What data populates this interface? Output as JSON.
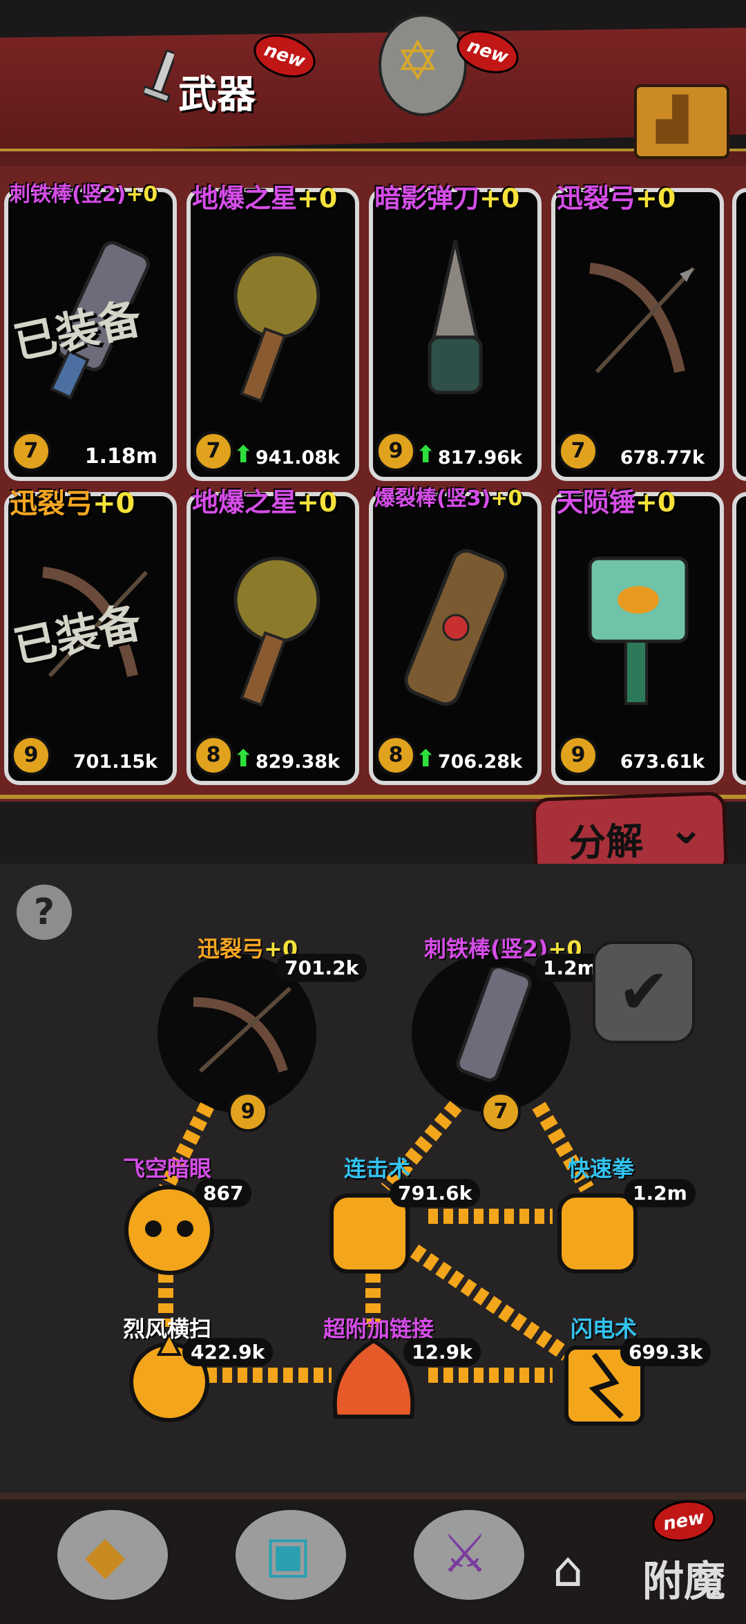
{
  "header": {
    "title": "武器",
    "new_badge_1": "new",
    "new_badge_2": "new"
  },
  "weapons": [
    {
      "name": "刺铁棒(竖2)",
      "plus": "+0",
      "level": "7",
      "value": "1.18m",
      "upgrade": false,
      "equipped_label": "已装备",
      "name_color": "#d64ee8"
    },
    {
      "name": "地爆之星",
      "plus": "+0",
      "level": "7",
      "value": "941.08k",
      "upgrade": true,
      "name_color": "#d64ee8"
    },
    {
      "name": "暗影弹刀",
      "plus": "+0",
      "level": "9",
      "value": "817.96k",
      "upgrade": true,
      "name_color": "#d64ee8"
    },
    {
      "name": "迅裂弓",
      "plus": "+0",
      "level": "7",
      "value": "678.77k",
      "upgrade": false,
      "name_color": "#d64ee8"
    },
    {
      "name": "迅裂弓",
      "plus": "+0",
      "level": "9",
      "value": "701.15k",
      "upgrade": false,
      "equipped_label": "已装备",
      "name_color": "#f5a623"
    },
    {
      "name": "地爆之星",
      "plus": "+0",
      "level": "8",
      "value": "829.38k",
      "upgrade": true,
      "name_color": "#d64ee8"
    },
    {
      "name": "爆裂棒(竖3)",
      "plus": "+0",
      "level": "8",
      "value": "706.28k",
      "upgrade": true,
      "name_color": "#d64ee8"
    },
    {
      "name": "天陨锤",
      "plus": "+0",
      "level": "9",
      "value": "673.61k",
      "upgrade": false,
      "name_color": "#d64ee8"
    }
  ],
  "decompose_label": "分解",
  "help_label": "?",
  "equipped_slots": [
    {
      "name": "迅裂弓",
      "plus": "+0",
      "value": "701.2k",
      "level": "9"
    },
    {
      "name": "刺铁棒(竖2)",
      "plus": "+0",
      "value": "1.2m",
      "level": "7"
    }
  ],
  "skills": [
    {
      "name": "飞空暗眼",
      "value": "867",
      "color": "#d64ee8"
    },
    {
      "name": "连击术",
      "value": "791.6k",
      "color": "#33c3f0"
    },
    {
      "name": "快速拳",
      "value": "1.2m",
      "color": "#33c3f0"
    },
    {
      "name": "烈风横扫",
      "value": "422.9k",
      "color": "#ffffff"
    },
    {
      "name": "超附加链接",
      "value": "12.9k",
      "color": "#d64ee8"
    },
    {
      "name": "闪电术",
      "value": "699.3k",
      "color": "#33c3f0"
    }
  ],
  "bottom_nav": {
    "enchant_label": "附魔",
    "new_badge": "new"
  },
  "colors": {
    "plus": "#f5e23a",
    "banner": "#6e2323",
    "node": "#f3a51b"
  }
}
